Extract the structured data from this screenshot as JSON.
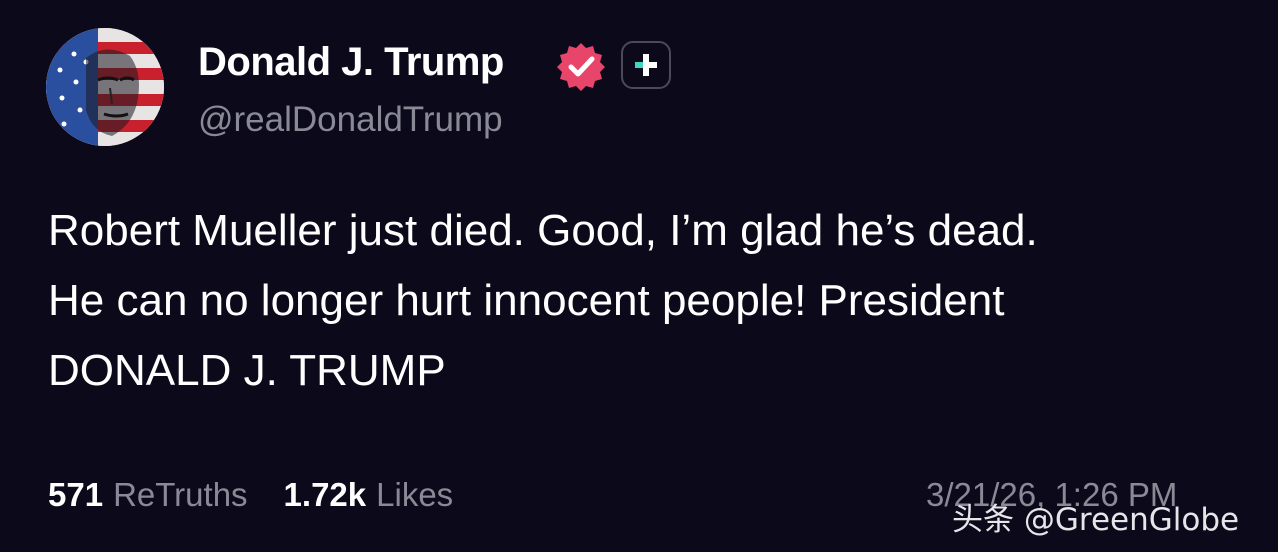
{
  "post": {
    "author": {
      "display_name": "Donald J. Trump",
      "handle": "@realDonaldTrump",
      "verified_icon": "verified-badge-icon",
      "verified_color": "#e8456b",
      "follow_icon": "plus-icon"
    },
    "text_lines": [
      "Robert Mueller just died. Good, I’m glad he’s dead.",
      "He can no longer hurt innocent people! President",
      "DONALD J. TRUMP"
    ],
    "stats": {
      "retruths_count": "571",
      "retruths_label": "ReTruths",
      "likes_count": "1.72k",
      "likes_label": "Likes"
    },
    "timestamp": "3/21/26, 1:26 PM"
  },
  "watermark": "头条 @GreenGlobe",
  "colors": {
    "background": "#0c0a1a",
    "primary_text": "#ffffff",
    "secondary_text": "#8a8a96",
    "accent": "#e8456b"
  }
}
